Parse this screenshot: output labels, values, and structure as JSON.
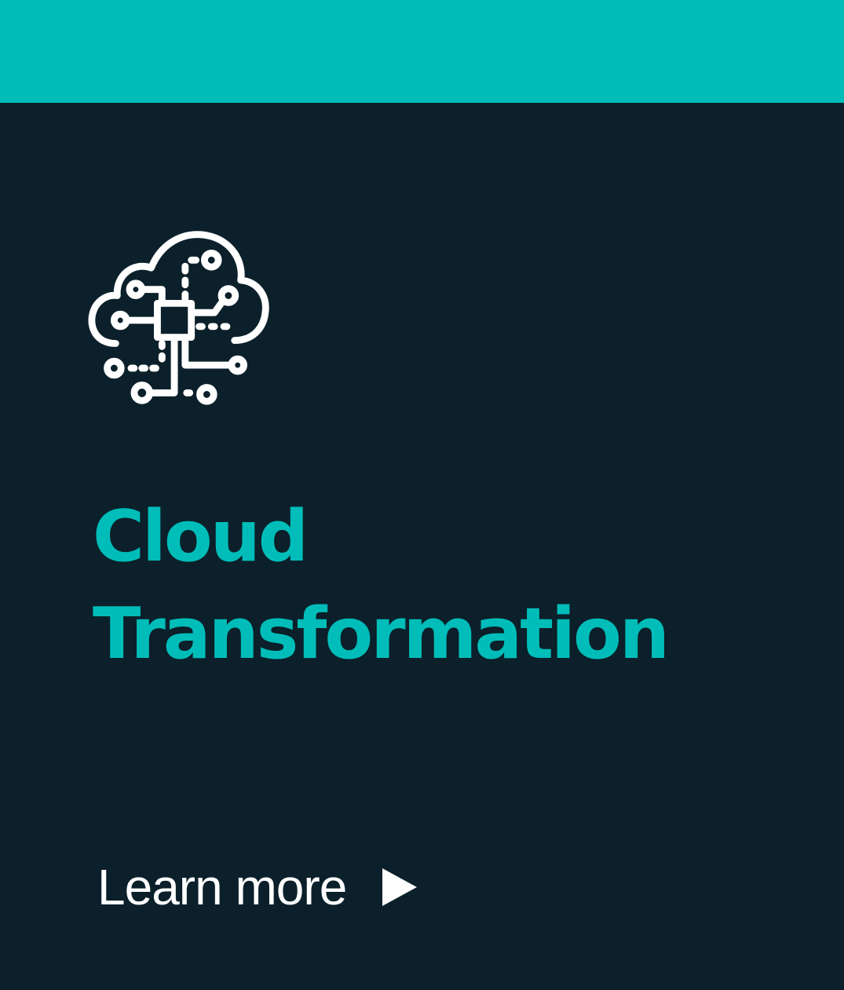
{
  "card": {
    "icon": "cloud-circuit-icon",
    "title_line1": "Cloud",
    "title_line2": "Transformation",
    "cta_label": "Learn more",
    "cta_icon": "play-arrow-icon"
  },
  "colors": {
    "accent": "#00bdb9",
    "background": "#0b202a",
    "text": "#ffffff"
  }
}
